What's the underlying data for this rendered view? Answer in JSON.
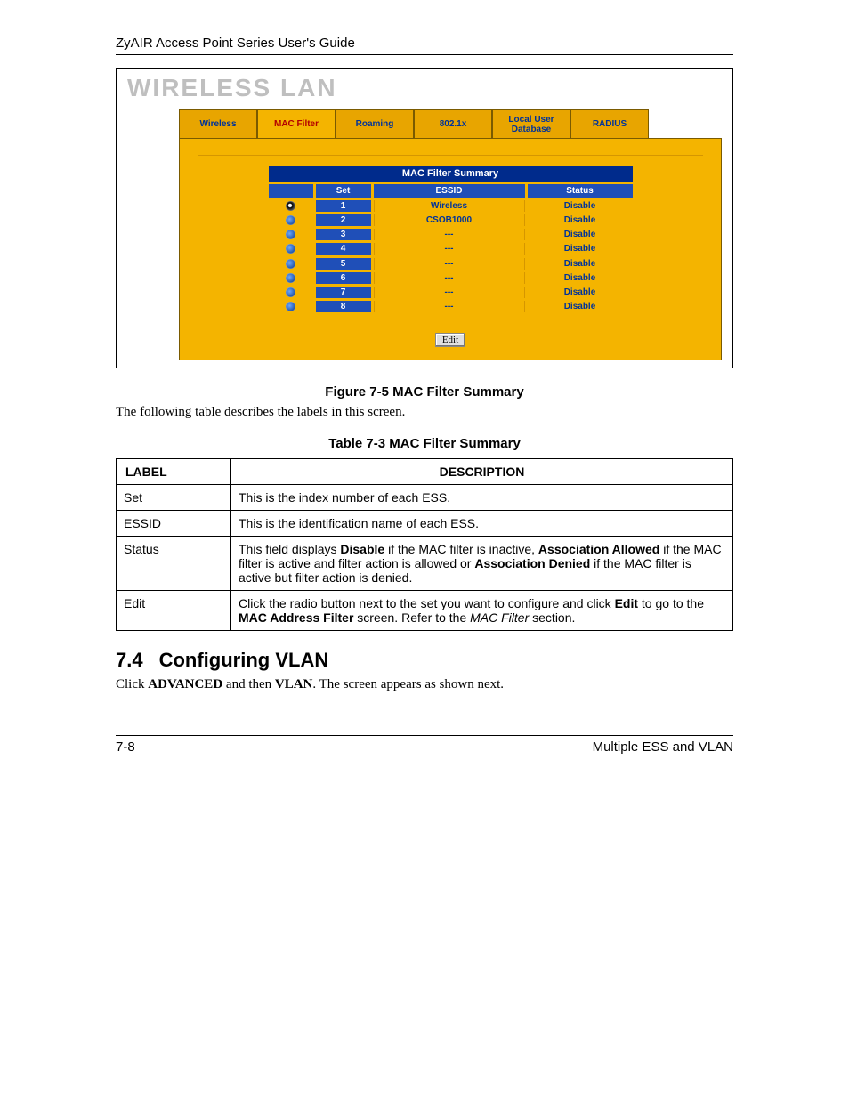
{
  "doc_header": "ZyAIR Access Point Series User's Guide",
  "screenshot": {
    "title": "WIRELESS LAN",
    "tabs": [
      "Wireless",
      "MAC Filter",
      "Roaming",
      "802.1x",
      "Local User Database",
      "RADIUS"
    ],
    "active_tab_index": 1,
    "summary_title": "MAC Filter Summary",
    "columns": {
      "set": "Set",
      "essid": "ESSID",
      "status": "Status"
    },
    "rows": [
      {
        "selected": true,
        "set": "1",
        "essid": "Wireless",
        "status": "Disable"
      },
      {
        "selected": false,
        "set": "2",
        "essid": "CSOB1000",
        "status": "Disable"
      },
      {
        "selected": false,
        "set": "3",
        "essid": "---",
        "status": "Disable"
      },
      {
        "selected": false,
        "set": "4",
        "essid": "---",
        "status": "Disable"
      },
      {
        "selected": false,
        "set": "5",
        "essid": "---",
        "status": "Disable"
      },
      {
        "selected": false,
        "set": "6",
        "essid": "---",
        "status": "Disable"
      },
      {
        "selected": false,
        "set": "7",
        "essid": "---",
        "status": "Disable"
      },
      {
        "selected": false,
        "set": "8",
        "essid": "---",
        "status": "Disable"
      }
    ],
    "edit_button": "Edit"
  },
  "figure_caption": "Figure 7-5 MAC Filter Summary",
  "intro_sentence": "The following table describes the labels in this screen.",
  "table_caption": "Table 7-3 MAC Filter Summary",
  "desc_table": {
    "headers": {
      "label": "LABEL",
      "description": "DESCRIPTION"
    },
    "rows": [
      {
        "label": "Set",
        "desc_html": "This is the index number of each ESS."
      },
      {
        "label": "ESSID",
        "desc_html": "This is the identification name of each ESS."
      },
      {
        "label": "Status",
        "desc_html": "This field displays <b>Disable</b> if the MAC filter is inactive, <b>Association Allowed</b> if the MAC filter is active and filter action is allowed or <b>Association Denied</b> if the MAC filter is active but filter action is denied."
      },
      {
        "label": "Edit",
        "desc_html": "Click the radio button next to the set you want to configure and click <b>Edit</b> to go to the <b>MAC Address Filter</b> screen. Refer to the <i>MAC Filter</i> section."
      }
    ]
  },
  "section": {
    "number": "7.4",
    "title": "Configuring VLAN",
    "body_html": "Click <b>ADVANCED</b> and then <b>VLAN</b>. The screen appears as shown next."
  },
  "footer": {
    "page_number": "7-8",
    "chapter": "Multiple ESS and VLAN"
  }
}
